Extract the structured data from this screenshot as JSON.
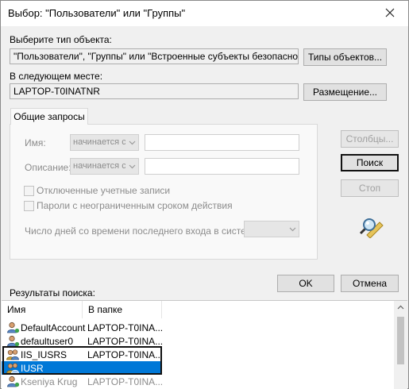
{
  "window": {
    "title": "Выбор: \"Пользователи\" или \"Группы\""
  },
  "object_type": {
    "label": "Выберите тип объекта:",
    "value": "\"Пользователи\", \"Группы\" или \"Встроенные субъекты безопасности\"",
    "button": "Типы объектов..."
  },
  "location": {
    "label": "В следующем месте:",
    "value": "LAPTOP-T0INATNR",
    "button": "Размещение..."
  },
  "queries": {
    "tab_label": "Общие запросы",
    "name_label": "Имя:",
    "name_op": "начинается с",
    "desc_label": "Описание:",
    "desc_op": "начинается с",
    "disabled_accounts": "Отключенные учетные записи",
    "no_expire_pw": "Пароли с неограниченным сроком действия",
    "days_label": "Число дней со времени последнего входа в систему:"
  },
  "buttons": {
    "columns": "Столбцы...",
    "find": "Поиск",
    "stop": "Стоп",
    "ok": "OK",
    "cancel": "Отмена"
  },
  "results": {
    "label": "Результаты поиска:",
    "columns": [
      "Имя",
      "В папке"
    ],
    "rows": [
      {
        "name": "DefaultAccount",
        "folder": "LAPTOP-T0INA...",
        "icon": "user-icon"
      },
      {
        "name": "defaultuser0",
        "folder": "LAPTOP-T0INA...",
        "icon": "user-icon"
      },
      {
        "name": "IIS_IUSRS",
        "folder": "LAPTOP-T0INA...",
        "icon": "group-icon"
      },
      {
        "name": "IUSR",
        "folder": "",
        "icon": "group-icon"
      },
      {
        "name": "Kseniya Krug",
        "folder": "LAPTOP-T0INA...",
        "icon": "user-icon"
      }
    ]
  },
  "colors": {
    "selection": "#0078d7",
    "highlight_box": "#111111"
  }
}
